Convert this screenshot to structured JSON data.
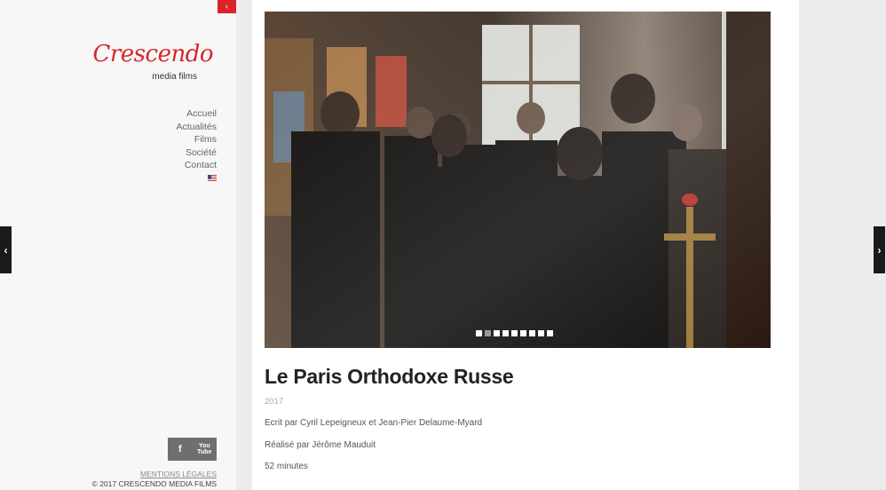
{
  "sidebar": {
    "collapse_icon": "‹",
    "logo": {
      "name": "Crescendo",
      "tagline": "media films",
      "color": "#d9252a"
    },
    "nav": [
      {
        "label": "Accueil"
      },
      {
        "label": "Actualités"
      },
      {
        "label": "Films"
      },
      {
        "label": "Société"
      },
      {
        "label": "Contact"
      }
    ],
    "language_flag": "us-flag-icon",
    "social": {
      "facebook_icon": "f",
      "youtube_icon_top": "You",
      "youtube_icon_bottom": "Tube"
    },
    "legal_link": "MENTIONS LÉGALES",
    "copyright": "© 2017 CRESCENDO MEDIA FILMS"
  },
  "slider": {
    "slide_count": 9,
    "active_index": 1
  },
  "film": {
    "title": "Le Paris Orthodoxe Russe",
    "year": "2017",
    "written_by": "Ecrit par Cyril Lepeigneux et Jean-Pier Delaume-Myard",
    "directed_by": "Réalisé par Jérôme Mauduit",
    "duration": "52 minutes"
  },
  "nav_arrows": {
    "prev": "‹",
    "next": "›"
  }
}
